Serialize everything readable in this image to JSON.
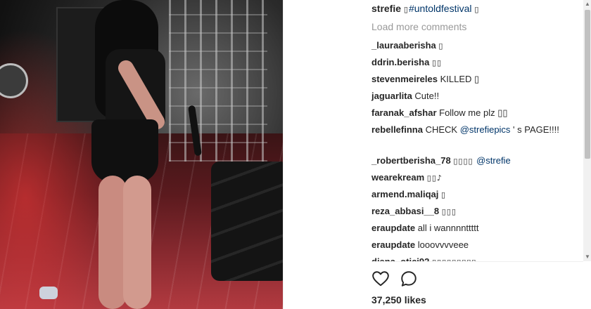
{
  "post": {
    "caption_user": "strefie",
    "caption_text": "#untoldfestival",
    "load_more": "Load more comments",
    "likes": "37,250 likes"
  },
  "comments": [
    {
      "user": "_lauraaberisha",
      "text": "▯"
    },
    {
      "user": "ddrin.berisha",
      "text": "▯▯"
    },
    {
      "user": "stevenmeireles",
      "text": "KILLED ▯"
    },
    {
      "user": "jaguarlita",
      "text": "Cute!!"
    },
    {
      "user": "faranak_afshar",
      "text": "Follow me plz ▯▯"
    },
    {
      "user": "rebellefinna",
      "text_pre": "CHECK ",
      "mention": "@strefiepics",
      "text_post": " ' s PAGE!!!!"
    },
    {
      "user": "_robertberisha_78",
      "text_pre": "▯▯▯▯ ",
      "mention": "@strefie",
      "text_post": ""
    },
    {
      "user": "wearekream",
      "text": "▯▯♪"
    },
    {
      "user": "armend.maliqaj",
      "text": "▯"
    },
    {
      "user": "reza_abbasi__8",
      "text": "▯▯▯"
    },
    {
      "user": "eraupdate",
      "text": "all i wannnnttttt"
    },
    {
      "user": "eraupdate",
      "text": "looovvvveee"
    },
    {
      "user": "diana_otici92",
      "text": "▯▯▯▯▯▯▯▯▯"
    }
  ],
  "icons": {
    "like": "heart-icon",
    "comment": "comment-icon"
  },
  "colors": {
    "text": "#262626",
    "muted": "#999999",
    "link": "#003569"
  }
}
